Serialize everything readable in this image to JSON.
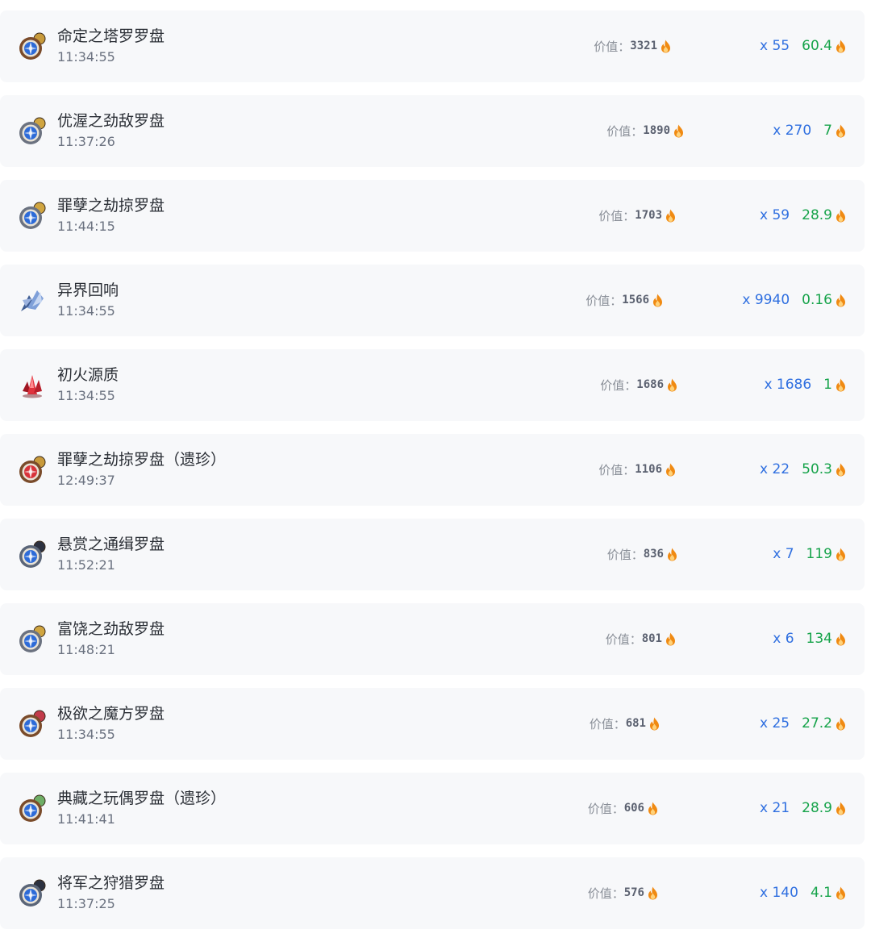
{
  "value_label": "价值：",
  "colors": {
    "row_background": "#f7f8fa",
    "name_text": "#2b2f36",
    "time_text": "#6b7280",
    "count_text": "#2f6fe0",
    "unit_price_text": "#16a34a",
    "flame": "#f08a12"
  },
  "items": [
    {
      "name": "命定之塔罗罗盘",
      "time": "11:34:55",
      "value": "3321",
      "count": "x 55",
      "unit_price": "60.4",
      "icon": "compass-tarot-icon"
    },
    {
      "name": "优渥之劲敌罗盘",
      "time": "11:37:26",
      "value": "1890",
      "count": "x 270",
      "unit_price": "7",
      "icon": "compass-gold-icon"
    },
    {
      "name": "罪孽之劫掠罗盘",
      "time": "11:44:15",
      "value": "1703",
      "count": "x 59",
      "unit_price": "28.9",
      "icon": "compass-gold-icon"
    },
    {
      "name": "异界回响",
      "time": "11:34:55",
      "value": "1566",
      "count": "x 9940",
      "unit_price": "0.16",
      "icon": "crystal-shard-icon"
    },
    {
      "name": "初火源质",
      "time": "11:34:55",
      "value": "1686",
      "count": "x 1686",
      "unit_price": "1",
      "icon": "red-crystal-icon"
    },
    {
      "name": "罪孽之劫掠罗盘（遗珍）",
      "time": "12:49:37",
      "value": "1106",
      "count": "x 22",
      "unit_price": "50.3",
      "icon": "compass-red-icon"
    },
    {
      "name": "悬赏之通缉罗盘",
      "time": "11:52:21",
      "value": "836",
      "count": "x 7",
      "unit_price": "119",
      "icon": "compass-dark-icon"
    },
    {
      "name": "富饶之劲敌罗盘",
      "time": "11:48:21",
      "value": "801",
      "count": "x 6",
      "unit_price": "134",
      "icon": "compass-gold-icon"
    },
    {
      "name": "极欲之魔方罗盘",
      "time": "11:34:55",
      "value": "681",
      "count": "x 25",
      "unit_price": "27.2",
      "icon": "compass-cube-icon"
    },
    {
      "name": "典藏之玩偶罗盘（遗珍）",
      "time": "11:41:41",
      "value": "606",
      "count": "x 21",
      "unit_price": "28.9",
      "icon": "compass-doll-icon"
    },
    {
      "name": "将军之狩猎罗盘",
      "time": "11:37:25",
      "value": "576",
      "count": "x 140",
      "unit_price": "4.1",
      "icon": "compass-dark-icon"
    }
  ]
}
